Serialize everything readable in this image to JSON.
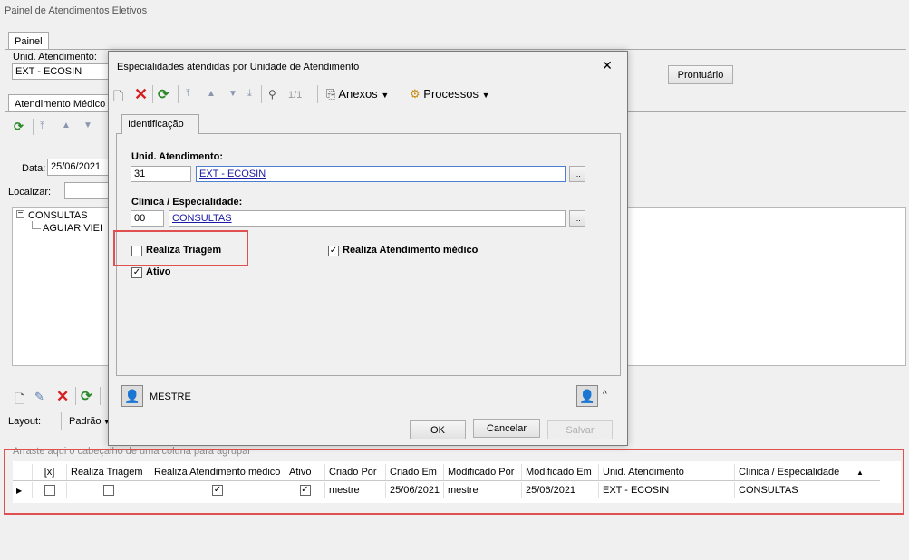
{
  "app_title": "Painel de Atendimentos Eletivos",
  "main_tab": "Painel",
  "unid_label": "Unid. Atendimento:",
  "unid_value": "EXT - ECOSIN",
  "prontuario_button": "Prontuário",
  "sub_tab": "Atendimento Médico",
  "data_label": "Data:",
  "data_value": "25/06/2021",
  "localizar_label": "Localizar:",
  "tree": {
    "root": "CONSULTAS",
    "child": "AGUIAR VIEI"
  },
  "layout_label": "Layout:",
  "layout_value": "Padrão",
  "group_hint": "Arraste aqui o cabeçalho de uma coluna para agrupar",
  "dialog": {
    "title": "Especialidades atendidas por Unidade de Atendimento",
    "nav_count": "1/1",
    "anexos": "Anexos",
    "processos": "Processos",
    "tab": "Identificação",
    "unid_label": "Unid. Atendimento:",
    "unid_code": "31",
    "unid_name": "EXT - ECOSIN",
    "clinica_label": "Clínica / Especialidade:",
    "clinica_code": "00",
    "clinica_name": "CONSULTAS",
    "ellipsis": "...",
    "triagem_label": "Realiza Triagem",
    "atendimento_label": "Realiza Atendimento médico",
    "ativo_label": "Ativo",
    "user": "MESTRE",
    "ok": "OK",
    "cancelar": "Cancelar",
    "salvar": "Salvar"
  },
  "grid": {
    "headers": [
      "[x]",
      "Realiza Triagem",
      "Realiza Atendimento médico",
      "Ativo",
      "Criado Por",
      "Criado Em",
      "Modificado Por",
      "Modificado Em",
      "Unid. Atendimento",
      "Clínica / Especialidade"
    ],
    "row": {
      "x": false,
      "triagem": false,
      "atendimento": true,
      "ativo": true,
      "criado_por": "mestre",
      "criado_em": "25/06/2021",
      "modificado_por": "mestre",
      "modificado_em": "25/06/2021",
      "unid": "EXT - ECOSIN",
      "clinica": "CONSULTAS"
    }
  },
  "colors": {
    "highlight": "#e05050",
    "link": "#1a1aa6",
    "refresh": "#2a8a2a",
    "delete": "#d42020"
  }
}
